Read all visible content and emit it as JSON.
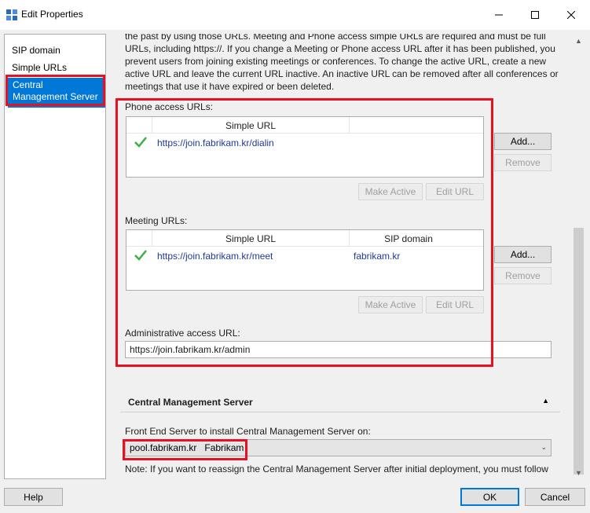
{
  "window": {
    "title": "Edit Properties"
  },
  "nav": {
    "items": [
      {
        "label": "SIP domain"
      },
      {
        "label": "Simple URLs"
      },
      {
        "label": "Central Management Server"
      }
    ],
    "selected_index": 2
  },
  "description": "the past by using those URLs. Meeting and Phone access simple URLs are required and must be full URLs, including https://. If you change a Meeting or Phone access URL after it has been published, you prevent users from joining existing meetings or conferences. To change the active URL, create a new active URL and leave the current URL inactive. An inactive URL can be removed after all conferences or meetings that use it have expired or been deleted.",
  "phone": {
    "label": "Phone access URLs:",
    "columns": [
      "Simple URL"
    ],
    "rows": [
      {
        "active": true,
        "url": "https://join.fabrikam.kr/dialin"
      }
    ],
    "add_label": "Add...",
    "remove_label": "Remove",
    "make_active_label": "Make Active",
    "edit_url_label": "Edit URL"
  },
  "meeting": {
    "label": "Meeting URLs:",
    "columns": [
      "Simple URL",
      "SIP domain"
    ],
    "rows": [
      {
        "active": true,
        "url": "https://join.fabrikam.kr/meet",
        "sip_domain": "fabrikam.kr"
      }
    ],
    "add_label": "Add...",
    "remove_label": "Remove",
    "make_active_label": "Make Active",
    "edit_url_label": "Edit URL"
  },
  "admin": {
    "label": "Administrative access URL:",
    "value": "https://join.fabrikam.kr/admin"
  },
  "cms": {
    "section_title": "Central Management Server",
    "front_end_label": "Front End Server to install Central Management Server on:",
    "selected_server": "pool.fabrikam.kr   Fabrikam",
    "note": "Note: If you want to reassign the Central Management Server after initial deployment, you must follow"
  },
  "footer": {
    "help_label": "Help",
    "ok_label": "OK",
    "cancel_label": "Cancel"
  },
  "colors": {
    "selection": "#0078d7",
    "highlight_box": "#e81123",
    "check": "#3cb043"
  }
}
